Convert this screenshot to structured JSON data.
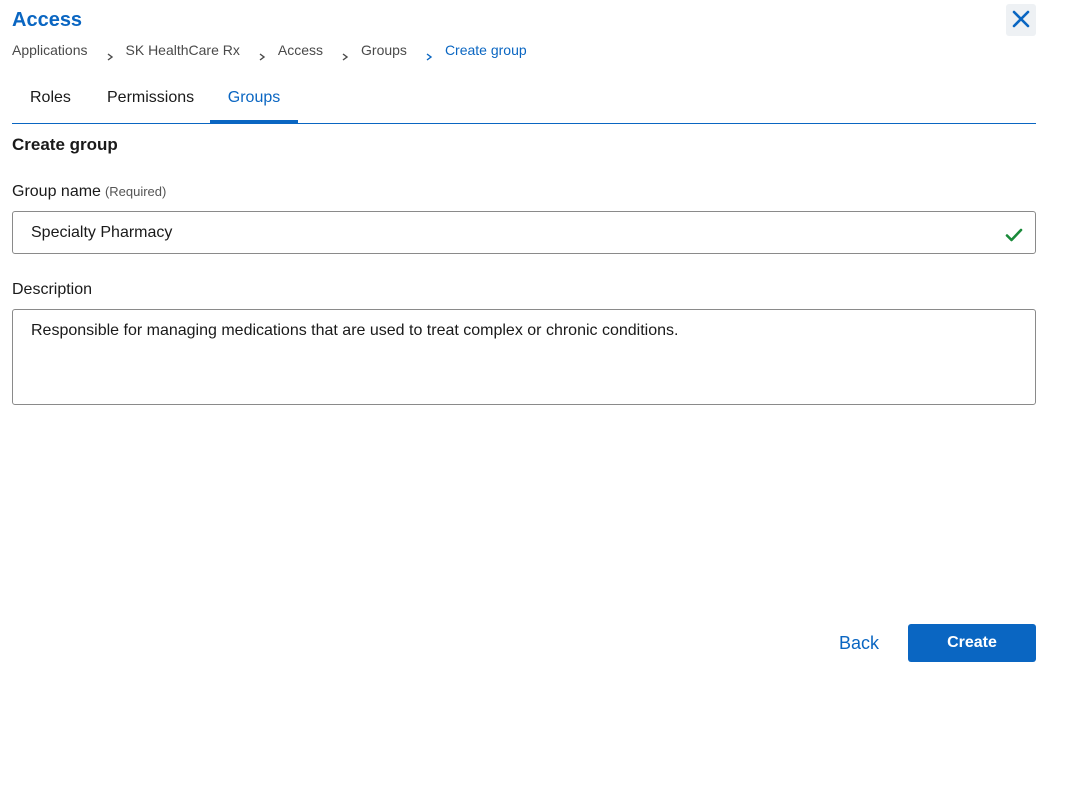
{
  "header": {
    "title": "Access"
  },
  "breadcrumb": [
    {
      "label": "Applications"
    },
    {
      "label": "SK HealthCare Rx"
    },
    {
      "label": "Access"
    },
    {
      "label": "Groups"
    },
    {
      "label": "Create group"
    }
  ],
  "tabs": [
    {
      "label": "Roles",
      "active": false
    },
    {
      "label": "Permissions",
      "active": false
    },
    {
      "label": "Groups",
      "active": true
    }
  ],
  "form": {
    "title": "Create group",
    "group_name": {
      "label": "Group name",
      "required_text": "(Required)",
      "value": "Specialty Pharmacy",
      "status_icon": "checkmark-icon"
    },
    "description": {
      "label": "Description",
      "value": "Responsible for managing medications that are used to treat complex or chronic conditions."
    }
  },
  "actions": {
    "back_label": "Back",
    "create_label": "Create"
  },
  "icons": {
    "close": "close-icon",
    "separator": "chevron-right-icon",
    "valid": "checkmark-icon"
  },
  "colors": {
    "accent": "#0a66c2",
    "success": "#1a8a3a",
    "border": "#8a8a8a",
    "close_bg": "#eef1f4"
  }
}
